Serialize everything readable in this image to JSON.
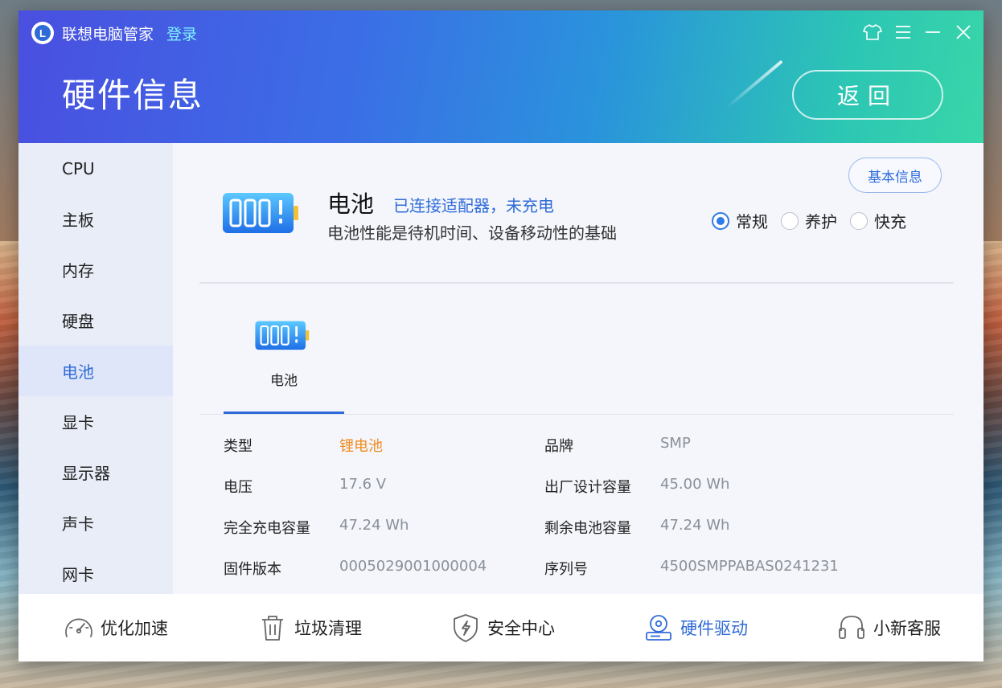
{
  "app": {
    "title": "联想电脑管家",
    "login": "登录",
    "page_title": "硬件信息",
    "back": "返回",
    "icons": {
      "logo": "lenovo-logo-L",
      "skin": "tshirt-icon",
      "menu": "hamburger-icon",
      "minimize": "minimize-icon",
      "close": "close-icon"
    }
  },
  "sidebar": {
    "items": [
      {
        "label": "CPU"
      },
      {
        "label": "主板"
      },
      {
        "label": "内存"
      },
      {
        "label": "硬盘"
      },
      {
        "label": "电池",
        "active": true
      },
      {
        "label": "显卡"
      },
      {
        "label": "显示器"
      },
      {
        "label": "声卡"
      },
      {
        "label": "网卡"
      }
    ]
  },
  "battery": {
    "basic_info_button": "基本信息",
    "name": "电池",
    "status": "已连接适配器，未充电",
    "description": "电池性能是待机时间、设备移动性的基础",
    "modes": [
      {
        "label": "常规",
        "checked": true
      },
      {
        "label": "养护",
        "checked": false
      },
      {
        "label": "快充",
        "checked": false
      }
    ],
    "device_tab": {
      "label": "电池"
    },
    "details": [
      {
        "label": "类型",
        "value": "锂电池",
        "highlight": true
      },
      {
        "label": "品牌",
        "value": "SMP"
      },
      {
        "label": "电压",
        "value": "17.6 V"
      },
      {
        "label": "出厂设计容量",
        "value": "45.00 Wh"
      },
      {
        "label": "完全充电容量",
        "value": "47.24 Wh"
      },
      {
        "label": "剩余电池容量",
        "value": "47.24 Wh"
      },
      {
        "label": "固件版本",
        "value": "0005029001000004"
      },
      {
        "label": "序列号",
        "value": "4500SMPPABAS0241231"
      }
    ]
  },
  "bottom_nav": {
    "items": [
      {
        "label": "优化加速",
        "icon": "speedometer-icon"
      },
      {
        "label": "垃圾清理",
        "icon": "trash-icon"
      },
      {
        "label": "安全中心",
        "icon": "shield-icon"
      },
      {
        "label": "硬件驱动",
        "icon": "hardware-drive-icon",
        "active": true
      },
      {
        "label": "小新客服",
        "icon": "headset-icon"
      }
    ]
  },
  "colors": {
    "accent": "#2f6bd8",
    "highlight_value": "#f08b1d",
    "header_gradient_start": "#4a4fe0",
    "header_gradient_end": "#39d6a9"
  }
}
